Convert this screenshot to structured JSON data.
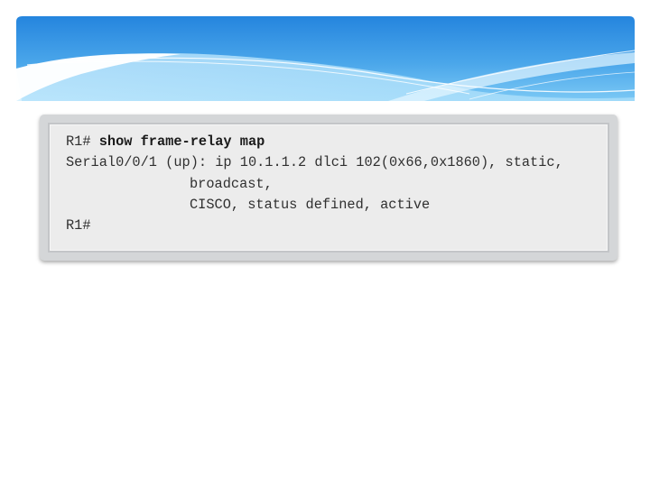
{
  "terminal": {
    "prompt_1": "R1# ",
    "command": "show frame-relay map",
    "output_line_1": "Serial0/0/1 (up): ip 10.1.1.2 dlci 102(0x66,0x1860), static,",
    "output_line_2": "broadcast,",
    "output_line_3": "CISCO, status defined, active",
    "prompt_2": "R1#"
  },
  "colors": {
    "banner_top": "#2a8ee0",
    "banner_light": "#8cd2f7",
    "terminal_frame": "#d4d6d8",
    "terminal_background": "#ececec",
    "text": "#303030"
  }
}
